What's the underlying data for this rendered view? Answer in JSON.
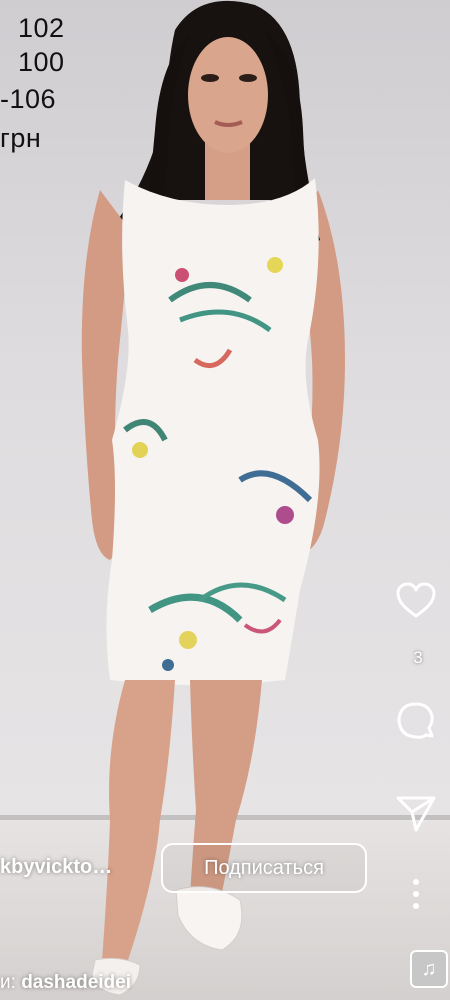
{
  "overlay_lines": [
    "102",
    "100",
    "-106",
    "грн"
  ],
  "post": {
    "username": "kbyvickto…",
    "subscribe_label": "Подписаться",
    "likes_count": "3",
    "music_prefix": "и:",
    "music_author": "dashadeidei"
  },
  "icons": {
    "like": "heart-icon",
    "comment": "comment-icon",
    "share": "send-icon",
    "more": "more-vertical-icon",
    "audio": "music-note-icon"
  }
}
